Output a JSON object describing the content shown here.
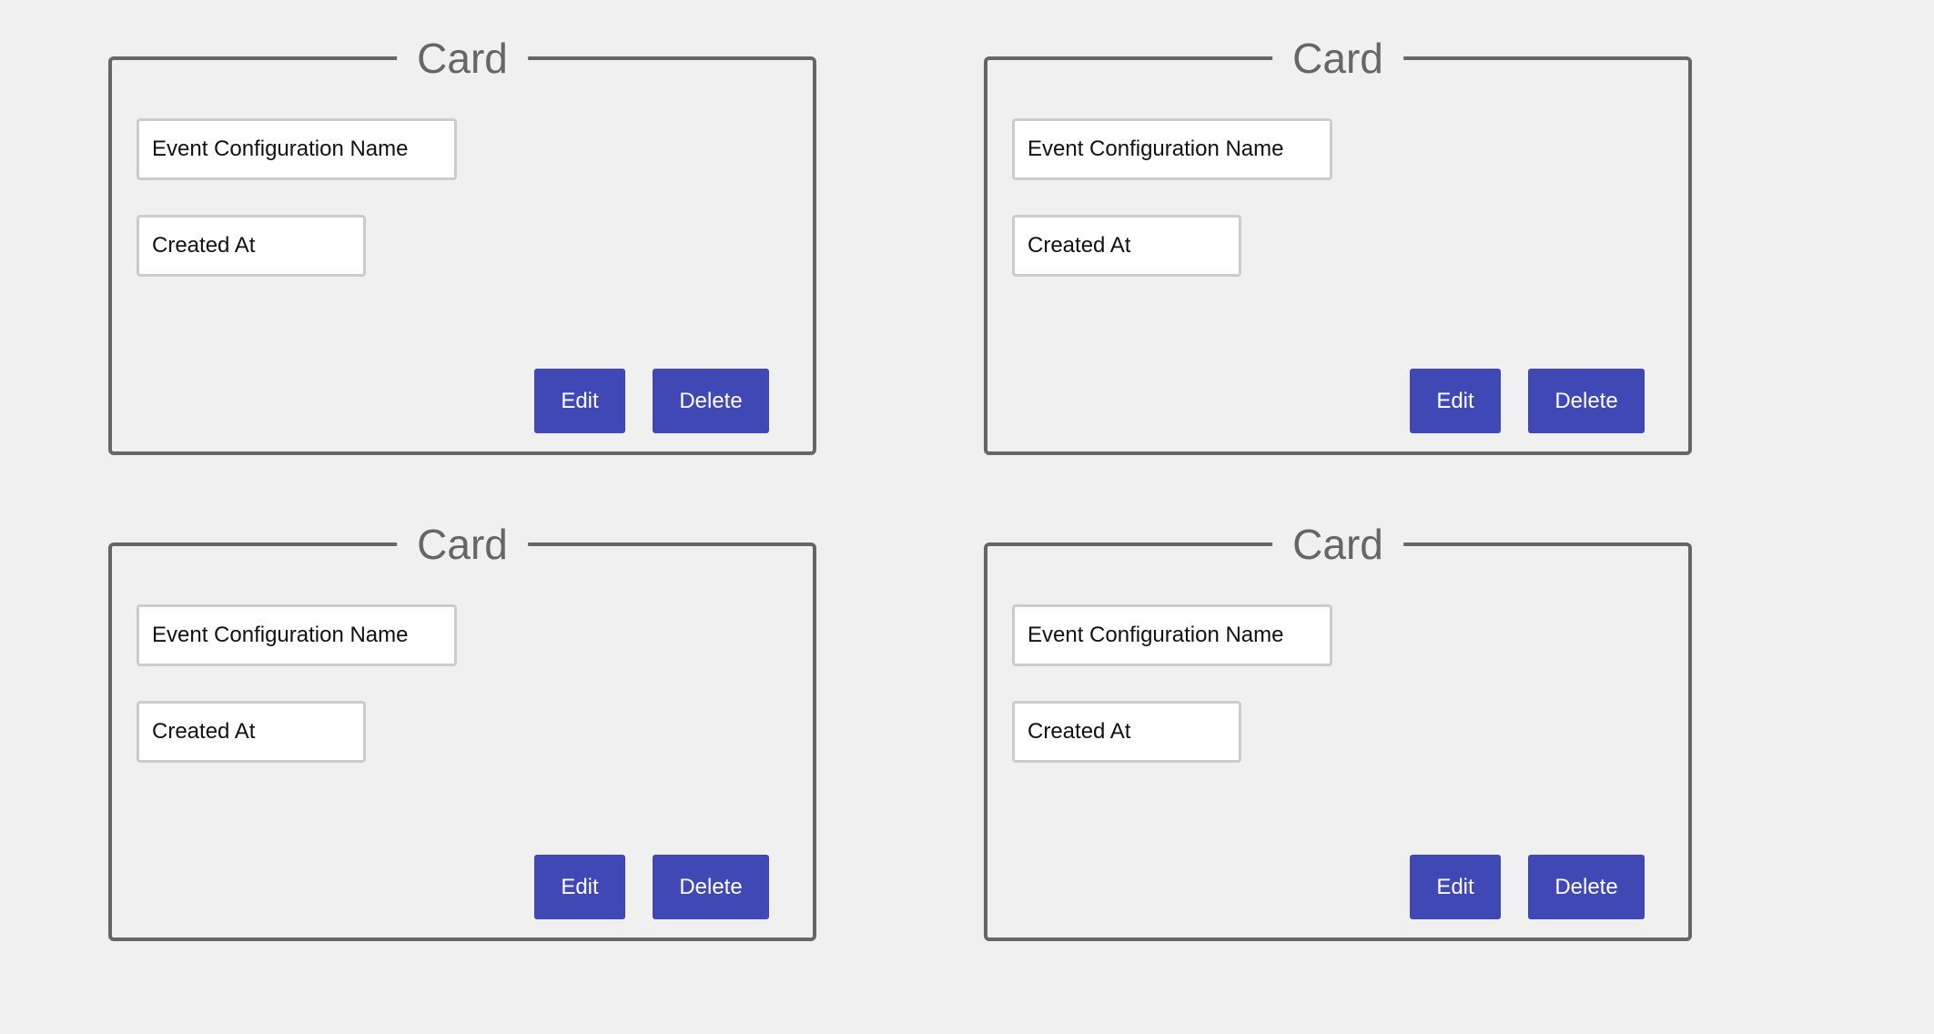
{
  "cards": [
    {
      "title": "Card",
      "name_field": "Event Configuration Name",
      "created_field": "Created At",
      "edit_label": "Edit",
      "delete_label": "Delete"
    },
    {
      "title": "Card",
      "name_field": "Event Configuration Name",
      "created_field": "Created At",
      "edit_label": "Edit",
      "delete_label": "Delete"
    },
    {
      "title": "Card",
      "name_field": "Event Configuration Name",
      "created_field": "Created At",
      "edit_label": "Edit",
      "delete_label": "Delete"
    },
    {
      "title": "Card",
      "name_field": "Event Configuration Name",
      "created_field": "Created At",
      "edit_label": "Edit",
      "delete_label": "Delete"
    }
  ],
  "colors": {
    "background": "#f0f0f0",
    "border": "#666666",
    "button": "#3f48b4",
    "button_text": "#ffffff"
  }
}
